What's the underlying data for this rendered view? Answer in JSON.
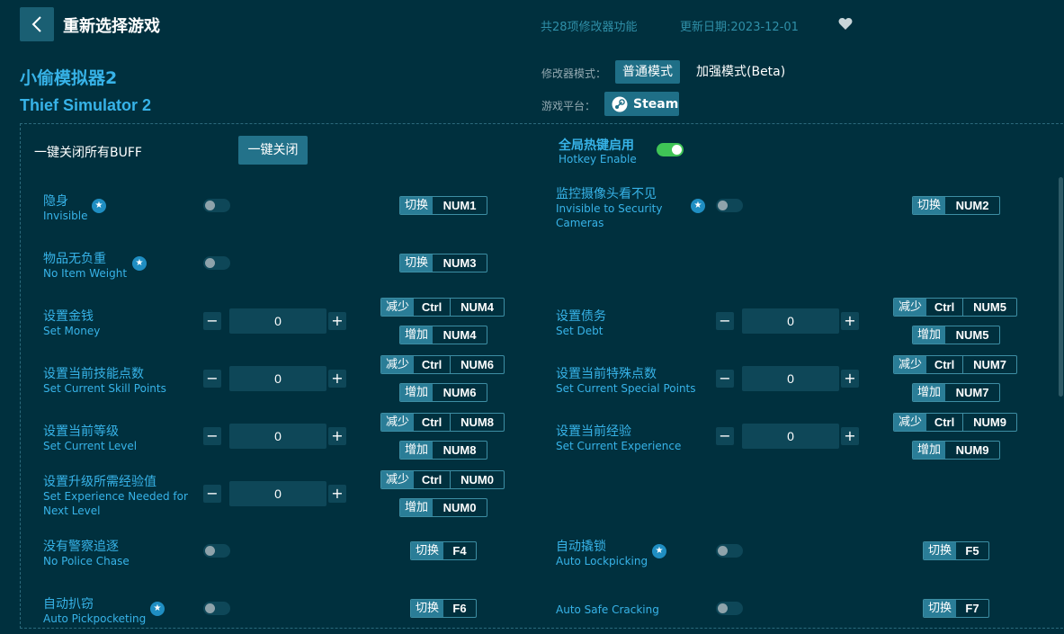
{
  "header": {
    "back_label": "<",
    "title": "重新选择游戏",
    "feature_count": "共28项修改器功能",
    "update_date": "更新日期:2023-12-01"
  },
  "game": {
    "title_cn": "小偷模拟器2",
    "title_en": "Thief Simulator 2"
  },
  "mode": {
    "label": "修改器模式：",
    "normal": "普通模式",
    "beta": "加强模式(Beta)",
    "platform_label": "游戏平台：",
    "platform": "Steam"
  },
  "global": {
    "close_all_label": "一键关闭所有BUFF",
    "close_all_button": "一键关闭",
    "hotkey_cn": "全局热键启用",
    "hotkey_en": "Hotkey Enable",
    "hotkey_enabled": true
  },
  "keytags": {
    "toggle": "切换",
    "decrease": "减少",
    "increase": "增加",
    "ctrl": "Ctrl"
  },
  "cheats": {
    "invisible": {
      "cn": "隐身",
      "en": "Invisible",
      "key": "NUM1",
      "on": false
    },
    "security": {
      "cn": "监控摄像头看不见",
      "en1": "Invisible to Security",
      "en2": "Cameras",
      "key": "NUM2",
      "on": false
    },
    "weight": {
      "cn": "物品无负重",
      "en": "No Item Weight",
      "key": "NUM3",
      "on": false
    },
    "money": {
      "cn": "设置金钱",
      "en": "Set Money",
      "value": "0",
      "dec_key": "NUM4",
      "inc_key": "NUM4"
    },
    "debt": {
      "cn": "设置债务",
      "en": "Set Debt",
      "value": "0",
      "dec_key": "NUM5",
      "inc_key": "NUM5"
    },
    "skill": {
      "cn": "设置当前技能点数",
      "en": "Set Current Skill Points",
      "value": "0",
      "dec_key": "NUM6",
      "inc_key": "NUM6"
    },
    "special": {
      "cn": "设置当前特殊点数",
      "en": "Set Current Special Points",
      "value": "0",
      "dec_key": "NUM7",
      "inc_key": "NUM7"
    },
    "level": {
      "cn": "设置当前等级",
      "en": "Set Current Level",
      "value": "0",
      "dec_key": "NUM8",
      "inc_key": "NUM8"
    },
    "experience": {
      "cn": "设置当前经验",
      "en": "Set Current Experience",
      "value": "0",
      "dec_key": "NUM9",
      "inc_key": "NUM9"
    },
    "exp_needed": {
      "cn": "设置升级所需经验值",
      "en1": "Set Experience Needed for",
      "en2": "Next Level",
      "value": "0",
      "dec_key": "NUM0",
      "inc_key": "NUM0"
    },
    "police": {
      "cn": "没有警察追逐",
      "en": "No Police Chase",
      "key": "F4",
      "on": false
    },
    "lockpick": {
      "cn": "自动撬锁",
      "en": "Auto Lockpicking",
      "key": "F5",
      "on": false
    },
    "pickpocket": {
      "cn": "自动扒窃",
      "en": "Auto Pickpocketing",
      "key": "F6",
      "on": false
    },
    "safe": {
      "en": "Auto Safe Cracking",
      "key": "F7",
      "on": false
    }
  },
  "colors": {
    "background": "#00303e",
    "accent": "#37b3e8",
    "button": "#1f6f87",
    "toggle_on": "#3fc456"
  }
}
